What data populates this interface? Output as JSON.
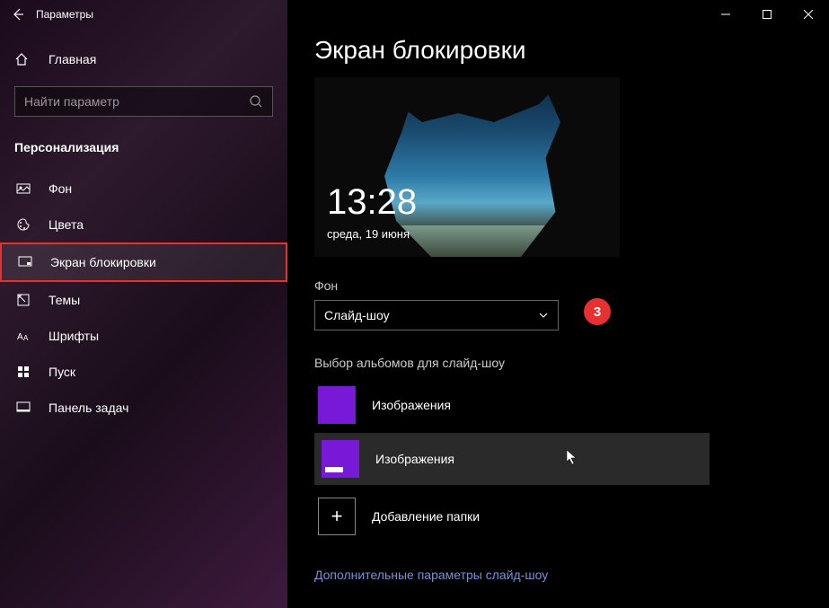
{
  "titlebar": {
    "title": "Параметры"
  },
  "sidebar": {
    "home_label": "Главная",
    "search_placeholder": "Найти параметр",
    "category": "Персонализация",
    "items": [
      {
        "label": "Фон",
        "icon": "picture-icon"
      },
      {
        "label": "Цвета",
        "icon": "palette-icon"
      },
      {
        "label": "Экран блокировки",
        "icon": "lock-screen-icon",
        "selected": true
      },
      {
        "label": "Темы",
        "icon": "themes-icon"
      },
      {
        "label": "Шрифты",
        "icon": "fonts-icon"
      },
      {
        "label": "Пуск",
        "icon": "start-icon"
      },
      {
        "label": "Панель задач",
        "icon": "taskbar-icon"
      }
    ]
  },
  "content": {
    "page_title": "Экран блокировки",
    "preview": {
      "time": "13:28",
      "date": "среда, 19 июня"
    },
    "background_section": {
      "label": "Фон",
      "dropdown_value": "Слайд-шоу"
    },
    "annotation_badge": "3",
    "albums_section": {
      "label": "Выбор альбомов для слайд-шоу",
      "items": [
        {
          "label": "Изображения"
        },
        {
          "label": "Изображения"
        }
      ],
      "add_label": "Добавление папки"
    },
    "more_link": "Дополнительные параметры слайд-шоу"
  }
}
